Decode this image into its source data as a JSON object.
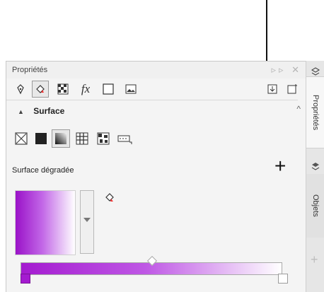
{
  "panel": {
    "title": "Propriétés",
    "header_controls": "▹▹ ✕"
  },
  "toolbar": {
    "items": [
      {
        "name": "pen-icon"
      },
      {
        "name": "fill-bucket-icon"
      },
      {
        "name": "transparency-icon"
      },
      {
        "name": "effects-icon",
        "label": "fx"
      },
      {
        "name": "frame-icon"
      },
      {
        "name": "image-icon"
      },
      {
        "name": "export-icon"
      },
      {
        "name": "new-page-icon"
      }
    ]
  },
  "section": {
    "title": "Surface",
    "chevron": "▲"
  },
  "fill_types": [
    {
      "name": "no-fill-icon"
    },
    {
      "name": "uniform-fill-icon"
    },
    {
      "name": "gradient-fill-icon"
    },
    {
      "name": "vector-pattern-icon"
    },
    {
      "name": "bitmap-pattern-icon"
    },
    {
      "name": "texture-fill-icon"
    }
  ],
  "gradient": {
    "label": "Surface dégradée",
    "add_symbol": "+",
    "start_color": "#a41bd0",
    "mid_color": "#bf58e5",
    "end_color": "#ffffff"
  },
  "side_tabs": {
    "properties": "Propriétés",
    "objects": "Objets",
    "add_symbol": "+"
  }
}
